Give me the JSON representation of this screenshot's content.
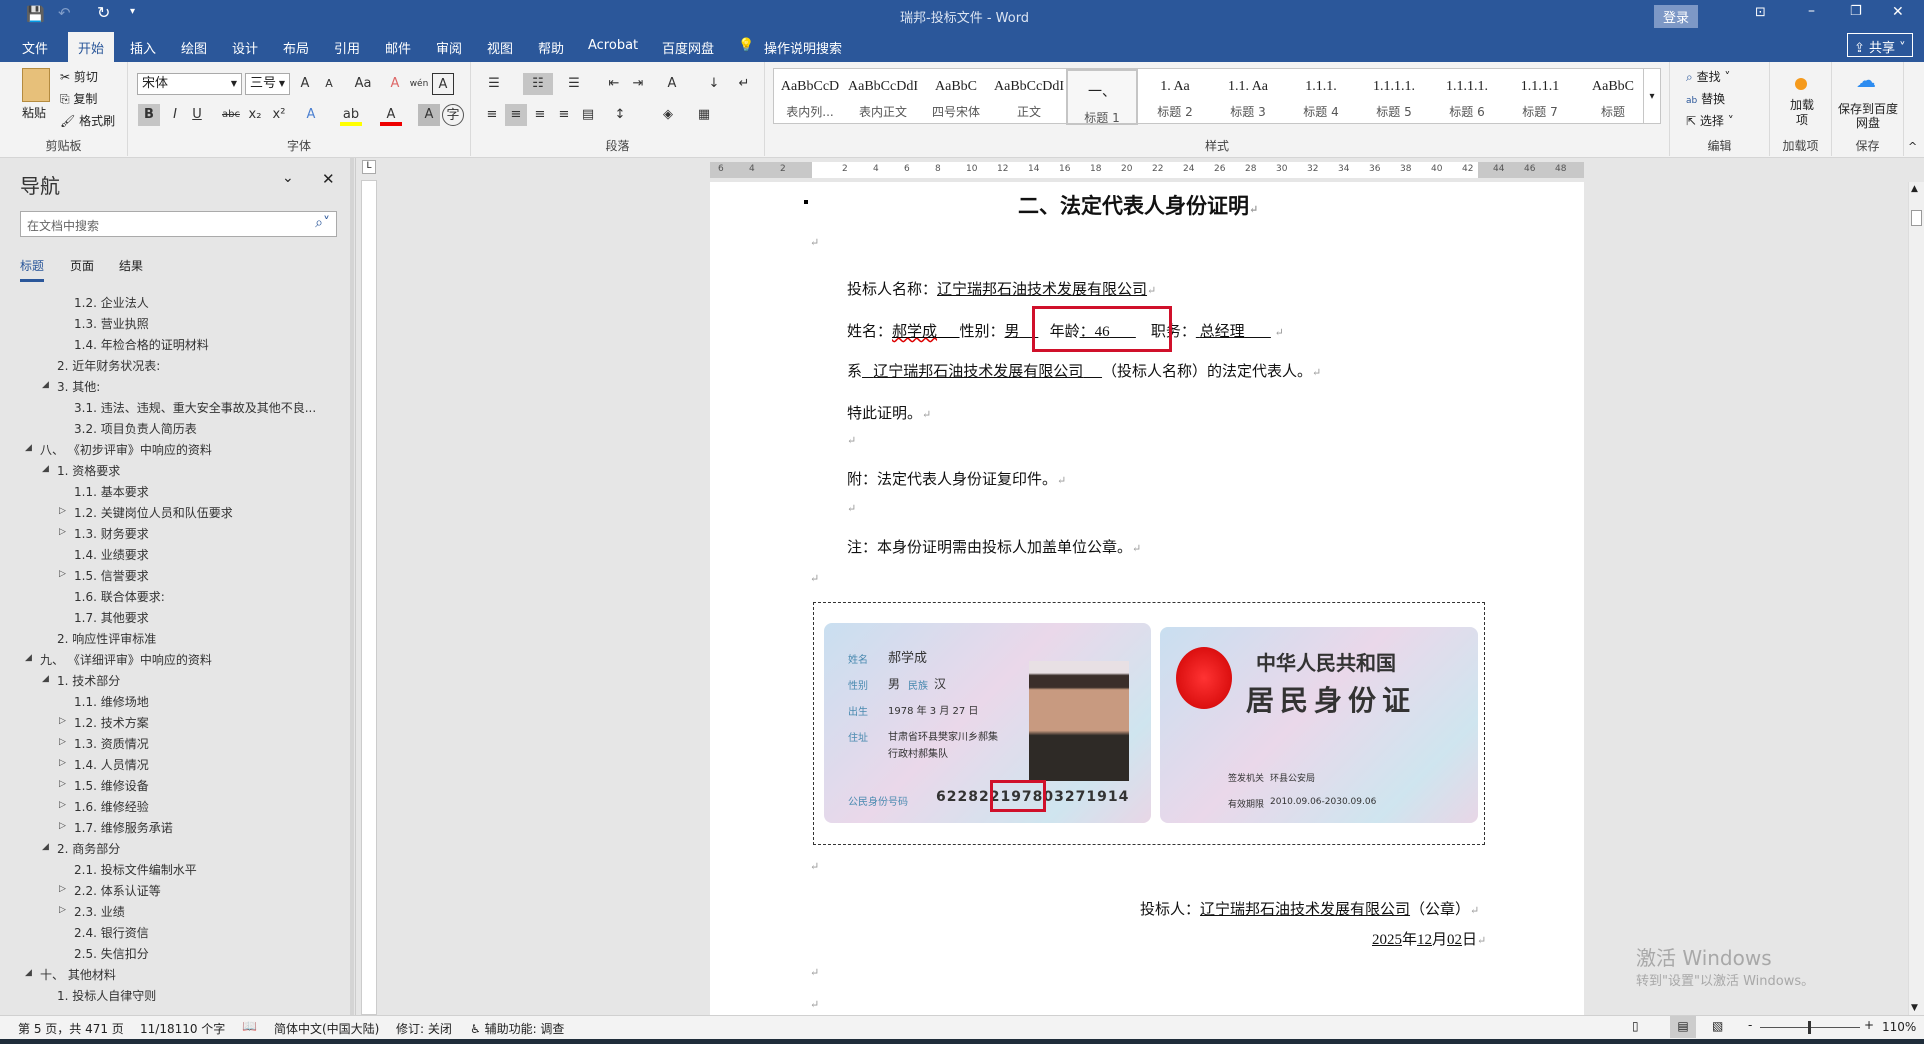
{
  "titlebar": {
    "title": "瑞邦-投标文件 - Word",
    "login": "登录",
    "share": "共享"
  },
  "tabs": [
    "文件",
    "开始",
    "插入",
    "绘图",
    "设计",
    "布局",
    "引用",
    "邮件",
    "审阅",
    "视图",
    "帮助",
    "Acrobat",
    "百度网盘"
  ],
  "tell_me": "操作说明搜索",
  "ribbon": {
    "clipboard": {
      "paste": "粘贴",
      "cut": "剪切",
      "copy": "复制",
      "format_painter": "格式刷",
      "label": "剪贴板"
    },
    "font": {
      "name": "宋体",
      "size": "三号",
      "label": "字体",
      "bold": "B",
      "italic": "I",
      "underline": "U"
    },
    "paragraph": {
      "label": "段落"
    },
    "styles": {
      "label": "样式",
      "items": [
        {
          "preview": "AaBbCcD",
          "name": "表内列..."
        },
        {
          "preview": "AaBbCcDdI",
          "name": "表内正文"
        },
        {
          "preview": "AaBbC",
          "name": "四号宋体"
        },
        {
          "preview": "AaBbCcDdI",
          "name": "正文"
        },
        {
          "preview": "一、",
          "name": "标题 1"
        },
        {
          "preview": "1.   Aa",
          "name": "标题 2"
        },
        {
          "preview": "1.1.  Aa",
          "name": "标题 3"
        },
        {
          "preview": "1.1.1.",
          "name": "标题 4"
        },
        {
          "preview": "1.1.1.1.",
          "name": "标题 5"
        },
        {
          "preview": "1.1.1.1.",
          "name": "标题 6"
        },
        {
          "preview": "1.1.1.1",
          "name": "标题 7"
        },
        {
          "preview": "AaBbC",
          "name": "标题"
        }
      ]
    },
    "editing": {
      "find": "查找",
      "replace": "替换",
      "select": "选择",
      "label": "编辑"
    },
    "addins": {
      "button": "加载项",
      "label": "加载项"
    },
    "baidu": {
      "button": "保存到百度网盘",
      "label": "保存"
    }
  },
  "nav": {
    "title": "导航",
    "search_placeholder": "在文档中搜索",
    "tabs": [
      "标题",
      "页面",
      "结果"
    ],
    "items": [
      {
        "t": "1.2. 企业法人",
        "l": 3,
        "a": ""
      },
      {
        "t": "1.3. 营业执照",
        "l": 3,
        "a": ""
      },
      {
        "t": "1.4. 年检合格的证明材料",
        "l": 3,
        "a": ""
      },
      {
        "t": "2. 近年财务状况表:",
        "l": 2,
        "a": ""
      },
      {
        "t": "3. 其他:",
        "l": 2,
        "a": "open"
      },
      {
        "t": "3.1. 违法、违规、重大安全事故及其他不良...",
        "l": 3,
        "a": ""
      },
      {
        "t": "3.2. 项目负责人简历表",
        "l": 3,
        "a": ""
      },
      {
        "t": "八、 《初步评审》中响应的资料",
        "l": 1,
        "a": "open"
      },
      {
        "t": "1. 资格要求",
        "l": 2,
        "a": "open"
      },
      {
        "t": "1.1. 基本要求",
        "l": 3,
        "a": ""
      },
      {
        "t": "1.2. 关键岗位人员和队伍要求",
        "l": 3,
        "a": "closed"
      },
      {
        "t": "1.3. 财务要求",
        "l": 3,
        "a": "closed"
      },
      {
        "t": "1.4. 业绩要求",
        "l": 3,
        "a": ""
      },
      {
        "t": "1.5. 信誉要求",
        "l": 3,
        "a": "closed"
      },
      {
        "t": "1.6. 联合体要求:",
        "l": 3,
        "a": ""
      },
      {
        "t": "1.7. 其他要求",
        "l": 3,
        "a": ""
      },
      {
        "t": "2. 响应性评审标准",
        "l": 2,
        "a": ""
      },
      {
        "t": "九、 《详细评审》中响应的资料",
        "l": 1,
        "a": "open"
      },
      {
        "t": "1. 技术部分",
        "l": 2,
        "a": "open"
      },
      {
        "t": "1.1. 维修场地",
        "l": 3,
        "a": ""
      },
      {
        "t": "1.2. 技术方案",
        "l": 3,
        "a": "closed"
      },
      {
        "t": "1.3. 资质情况",
        "l": 3,
        "a": "closed"
      },
      {
        "t": "1.4. 人员情况",
        "l": 3,
        "a": "closed"
      },
      {
        "t": "1.5. 维修设备",
        "l": 3,
        "a": "closed"
      },
      {
        "t": "1.6. 维修经验",
        "l": 3,
        "a": "closed"
      },
      {
        "t": "1.7. 维修服务承诺",
        "l": 3,
        "a": "closed"
      },
      {
        "t": "2. 商务部分",
        "l": 2,
        "a": "open"
      },
      {
        "t": "2.1. 投标文件编制水平",
        "l": 3,
        "a": ""
      },
      {
        "t": "2.2. 体系认证等",
        "l": 3,
        "a": "closed"
      },
      {
        "t": "2.3. 业绩",
        "l": 3,
        "a": "closed"
      },
      {
        "t": "2.4. 银行资信",
        "l": 3,
        "a": ""
      },
      {
        "t": "2.5. 失信扣分",
        "l": 3,
        "a": ""
      },
      {
        "t": "十、 其他材料",
        "l": 1,
        "a": "open"
      },
      {
        "t": "1. 投标人自律守则",
        "l": 2,
        "a": ""
      }
    ]
  },
  "ruler": [
    "6",
    "4",
    "2",
    "",
    "2",
    "4",
    "6",
    "8",
    "10",
    "12",
    "14",
    "16",
    "18",
    "20",
    "22",
    "24",
    "26",
    "28",
    "30",
    "32",
    "34",
    "36",
    "38",
    "40",
    "42",
    "44",
    "46",
    "48"
  ],
  "doc": {
    "heading": "二、法定代表人身份证明",
    "bidder_label": "投标人名称：",
    "bidder": "辽宁瑞邦石油技术发展有限公司",
    "name_label": "姓名：",
    "name": "郝学成",
    "gender_label": "性别：",
    "gender": "男",
    "age_label": "年龄",
    "age": "：46",
    "title_label": "职务：",
    "title": "总经理",
    "rep_prefix": "系",
    "rep_company": "辽宁瑞邦石油技术发展有限公司",
    "rep_suffix": "（投标人名称）的法定代表人。",
    "certify": "特此证明。",
    "attach": "附：法定代表人身份证复印件。",
    "note": "注：本身份证明需由投标人加盖单位公章。",
    "sign_label": "投标人：",
    "sign_company": "辽宁瑞邦石油技术发展有限公司",
    "seal": "（公章）",
    "date_year": "2025",
    "date_y": "年",
    "date_month": "12",
    "date_m": "月",
    "date_day": "02",
    "date_d": "日"
  },
  "id_front": {
    "name_l": "姓名",
    "name": "郝学成",
    "sex_l": "性别",
    "sex": "男",
    "eth_l": "民族",
    "eth": "汉",
    "birth_l": "出生",
    "birth": "1978 年 3 月 27 日",
    "addr_l": "住址",
    "addr1": "甘肃省环县樊家川乡郝集",
    "addr2": "行政村郝集队",
    "num_l": "公民身份号码",
    "num": "622822197803271914"
  },
  "id_back": {
    "country": "中华人民共和国",
    "card": "居民身份证",
    "issuer_l": "签发机关",
    "issuer": "环县公安局",
    "valid_l": "有效期限",
    "valid": "2010.09.06-2030.09.06"
  },
  "watermark": {
    "line1": "激活 Windows",
    "line2": "转到\"设置\"以激活 Windows。"
  },
  "status": {
    "page": "第 5 页，共 471 页",
    "words": "11/18110 个字",
    "lang": "简体中文(中国大陆)",
    "track": "修订: 关闭",
    "access": "辅助功能: 调查",
    "zoom": "110%"
  }
}
